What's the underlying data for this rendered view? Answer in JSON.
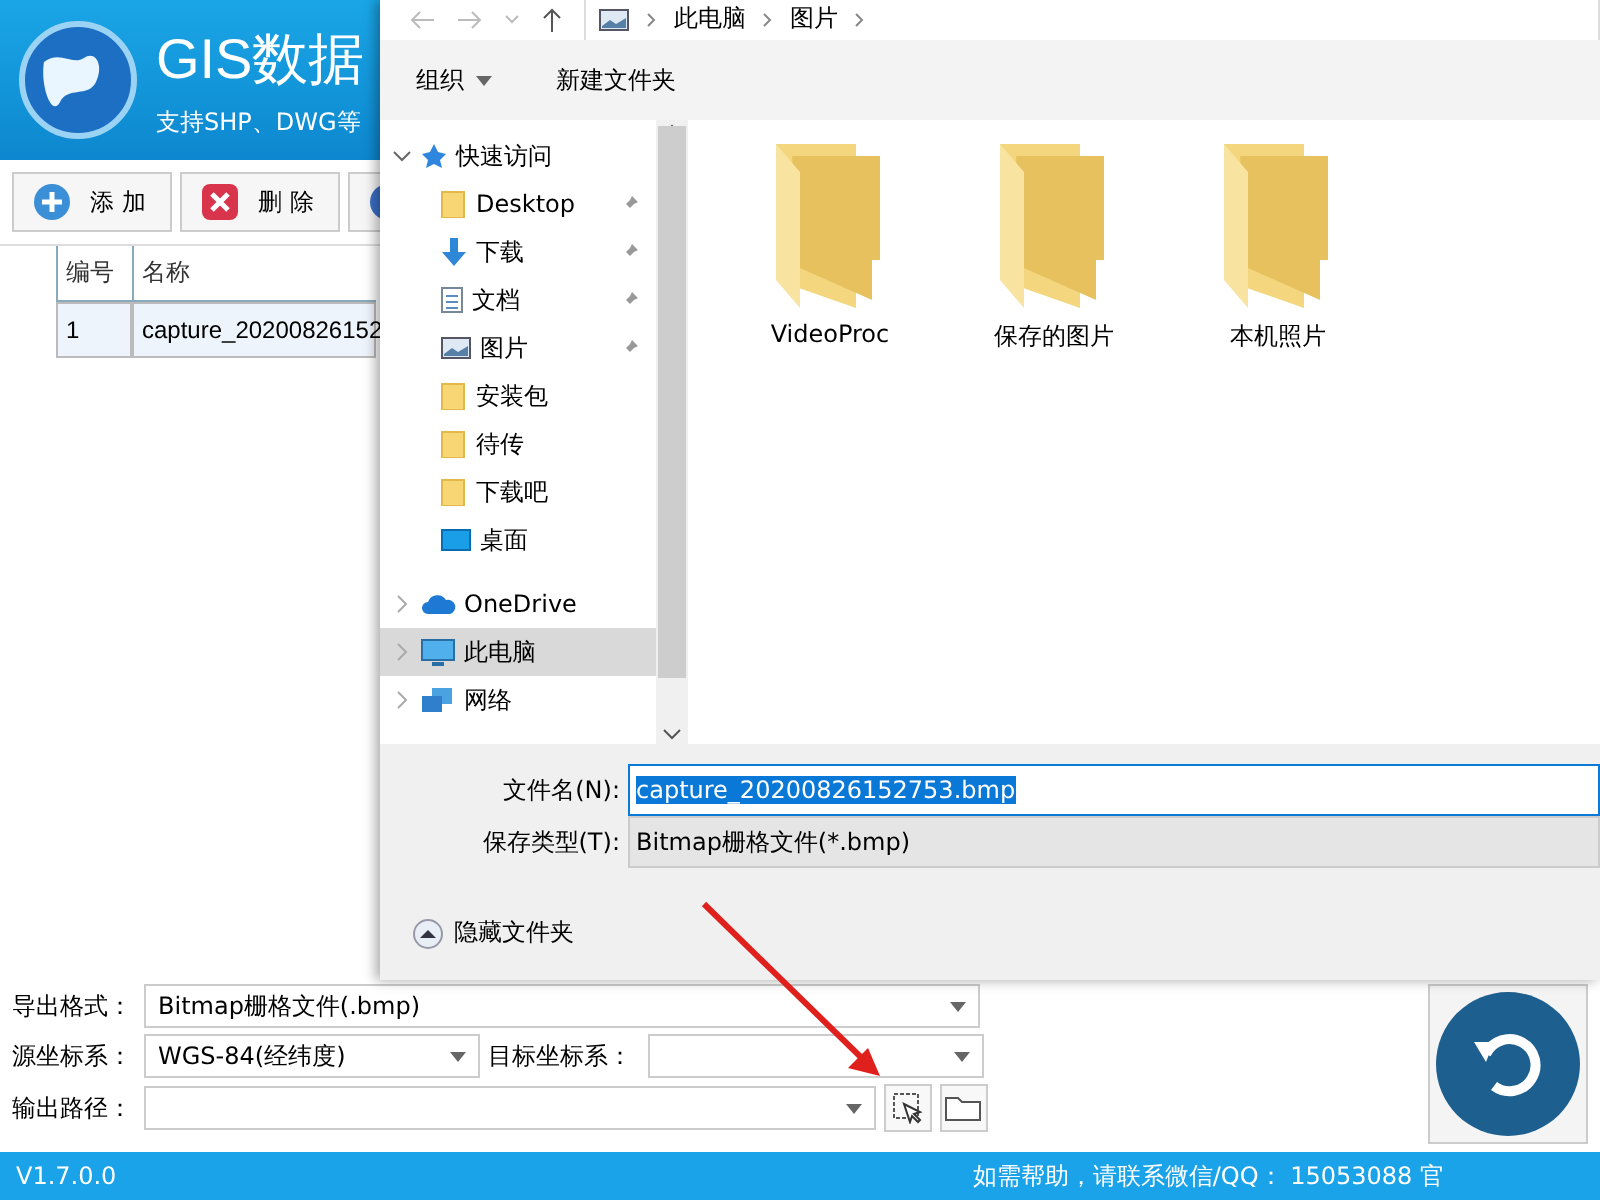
{
  "app": {
    "title": "GIS数据",
    "subtitle": "支持SHP、DWG等",
    "toolbar": [
      {
        "label": "添 加",
        "kind": "add"
      },
      {
        "label": "删 除",
        "kind": "delete"
      },
      {
        "kind": "partial"
      }
    ],
    "table": {
      "columns": [
        "编号",
        "名称"
      ],
      "rows": [
        {
          "cells": [
            "1",
            "capture_20200826152"
          ],
          "selected": true
        }
      ]
    },
    "form": {
      "export_format": {
        "label": "导出格式：",
        "value": "Bitmap栅格文件(.bmp)"
      },
      "source_crs": {
        "label": "源坐标系：",
        "value": "WGS-84(经纬度)"
      },
      "target_crs": {
        "label": "目标坐标系："
      },
      "output_path": {
        "label": "输出路径："
      }
    },
    "status_bar": {
      "version": "V1.7.0.0",
      "contact": "如需帮助，请联系微信/QQ： 15053088  官"
    }
  },
  "dialog": {
    "breadcrumb": [
      "此电脑",
      "图片"
    ],
    "toolbar": [
      {
        "label": "组织",
        "kind": "menu"
      },
      {
        "label": "新建文件夹",
        "kind": "plain"
      }
    ],
    "tree": [
      {
        "label": "快速访问",
        "kind": "star",
        "expanded": true,
        "selected": false,
        "children": [
          {
            "label": "Desktop",
            "kind": "folder",
            "pinned": true,
            "selected": false
          },
          {
            "label": "下载",
            "kind": "download",
            "pinned": true,
            "selected": false
          },
          {
            "label": "文档",
            "kind": "document",
            "pinned": true,
            "selected": false
          },
          {
            "label": "图片",
            "kind": "picture",
            "pinned": true,
            "selected": false
          },
          {
            "label": "安装包",
            "kind": "folder",
            "pinned": false,
            "selected": false
          },
          {
            "label": "待传",
            "kind": "folder",
            "pinned": false,
            "selected": false
          },
          {
            "label": "下载吧",
            "kind": "folder",
            "pinned": false,
            "selected": false
          },
          {
            "label": "桌面",
            "kind": "desktop",
            "pinned": false,
            "selected": false
          }
        ]
      },
      {
        "label": "OneDrive",
        "kind": "cloud",
        "expanded": false,
        "selected": false
      },
      {
        "label": "此电脑",
        "kind": "computer",
        "expanded": false,
        "selected": true
      },
      {
        "label": "网络",
        "kind": "network",
        "expanded": false,
        "selected": false
      }
    ],
    "folders": [
      "VideoProc",
      "保存的图片",
      "本机照片"
    ],
    "file_name": {
      "label": "文件名(N):",
      "value": "capture_20200826152753.bmp"
    },
    "save_type": {
      "label": "保存类型(T):",
      "value": "Bitmap栅格文件(*.bmp)"
    },
    "hide_folders": "隐藏文件夹"
  }
}
